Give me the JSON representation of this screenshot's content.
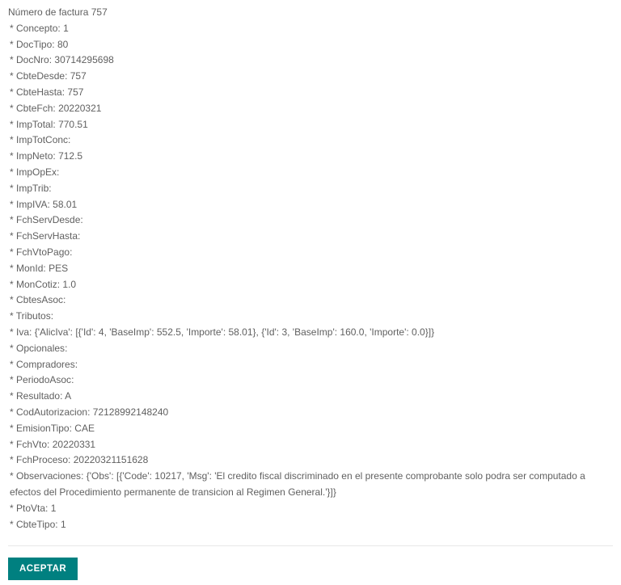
{
  "header": {
    "label_prefix": "Número de factura",
    "invoice_number": "757"
  },
  "fields": [
    {
      "label": "Concepto",
      "value": "1"
    },
    {
      "label": "DocTipo",
      "value": "80"
    },
    {
      "label": "DocNro",
      "value": "30714295698"
    },
    {
      "label": "CbteDesde",
      "value": "757"
    },
    {
      "label": "CbteHasta",
      "value": "757"
    },
    {
      "label": "CbteFch",
      "value": "20220321"
    },
    {
      "label": "ImpTotal",
      "value": "770.51"
    },
    {
      "label": "ImpTotConc",
      "value": ""
    },
    {
      "label": "ImpNeto",
      "value": "712.5"
    },
    {
      "label": "ImpOpEx",
      "value": ""
    },
    {
      "label": "ImpTrib",
      "value": ""
    },
    {
      "label": "ImpIVA",
      "value": "58.01"
    },
    {
      "label": "FchServDesde",
      "value": ""
    },
    {
      "label": "FchServHasta",
      "value": ""
    },
    {
      "label": "FchVtoPago",
      "value": ""
    },
    {
      "label": "MonId",
      "value": "PES"
    },
    {
      "label": "MonCotiz",
      "value": "1.0"
    },
    {
      "label": "CbtesAsoc",
      "value": ""
    },
    {
      "label": "Tributos",
      "value": ""
    },
    {
      "label": "Iva",
      "value": "{'AlicIva': [{'Id': 4, 'BaseImp': 552.5, 'Importe': 58.01}, {'Id': 3, 'BaseImp': 160.0, 'Importe': 0.0}]}"
    },
    {
      "label": "Opcionales",
      "value": ""
    },
    {
      "label": "Compradores",
      "value": ""
    },
    {
      "label": "PeriodoAsoc",
      "value": ""
    },
    {
      "label": "Resultado",
      "value": "A"
    },
    {
      "label": "CodAutorizacion",
      "value": "72128992148240"
    },
    {
      "label": "EmisionTipo",
      "value": "CAE"
    },
    {
      "label": "FchVto",
      "value": "20220331"
    },
    {
      "label": "FchProceso",
      "value": "20220321151628"
    },
    {
      "label": "Observaciones",
      "value": "{'Obs': [{'Code': 10217, 'Msg': 'El credito fiscal discriminado en el presente comprobante solo podra ser computado a efectos del Procedimiento permanente de transicion al Regimen General.'}]}"
    },
    {
      "label": "PtoVta",
      "value": "1"
    },
    {
      "label": "CbteTipo",
      "value": "1"
    }
  ],
  "button": {
    "accept_label": "ACEPTAR"
  }
}
